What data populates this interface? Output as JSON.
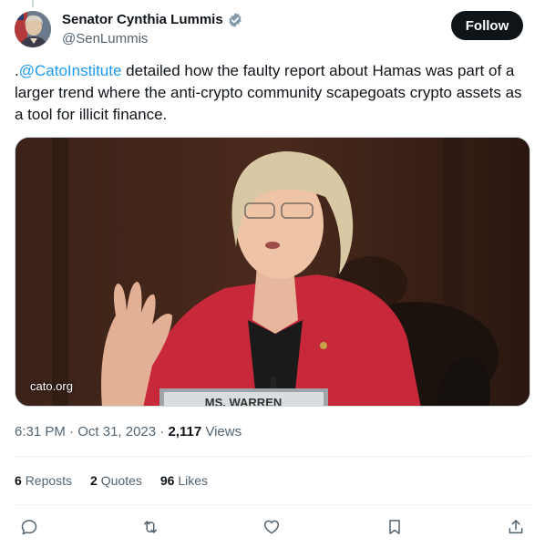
{
  "author": {
    "display_name": "Senator Cynthia Lummis",
    "handle": "@SenLummis",
    "verified_badge_color": "#829aab"
  },
  "follow_button": {
    "label": "Follow"
  },
  "tweet": {
    "prefix": ".",
    "mention": "@CatoInstitute",
    "body": " detailed how the faulty report about Hamas was part of a larger trend where the anti-crypto community scapegoats crypto assets as a tool for illicit finance.",
    "mention_color": "#1d9bf0"
  },
  "media": {
    "domain": "cato.org",
    "nameplate": "MS. WARREN"
  },
  "meta": {
    "time": "6:31 PM",
    "separator": " · ",
    "date": "Oct 31, 2023",
    "views_count": "2,117",
    "views_label": " Views"
  },
  "stats": {
    "reposts_count": "6",
    "reposts_label": "Reposts",
    "quotes_count": "2",
    "quotes_label": "Quotes",
    "likes_count": "96",
    "likes_label": "Likes"
  },
  "actions": [
    "reply-icon",
    "repost-icon",
    "like-icon",
    "bookmark-icon",
    "share-icon"
  ]
}
